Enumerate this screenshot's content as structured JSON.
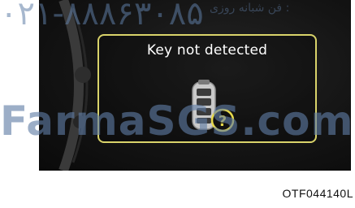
{
  "display": {
    "message": "Key not detected",
    "icons": {
      "key_fob": "smart-key-fob-icon",
      "question": "question-mark-icon"
    }
  },
  "watermark": {
    "top_number": "۰۲۱-۸۸۸۶۳۰۸۵",
    "top_persian": "فن شبانه روزی :",
    "middle_brand": "FarmaSGS.com"
  },
  "figure_code": "OTF044140L",
  "colors": {
    "popup_border": "#d9d36a",
    "background": "#141414",
    "watermark": "#5f7da5"
  }
}
